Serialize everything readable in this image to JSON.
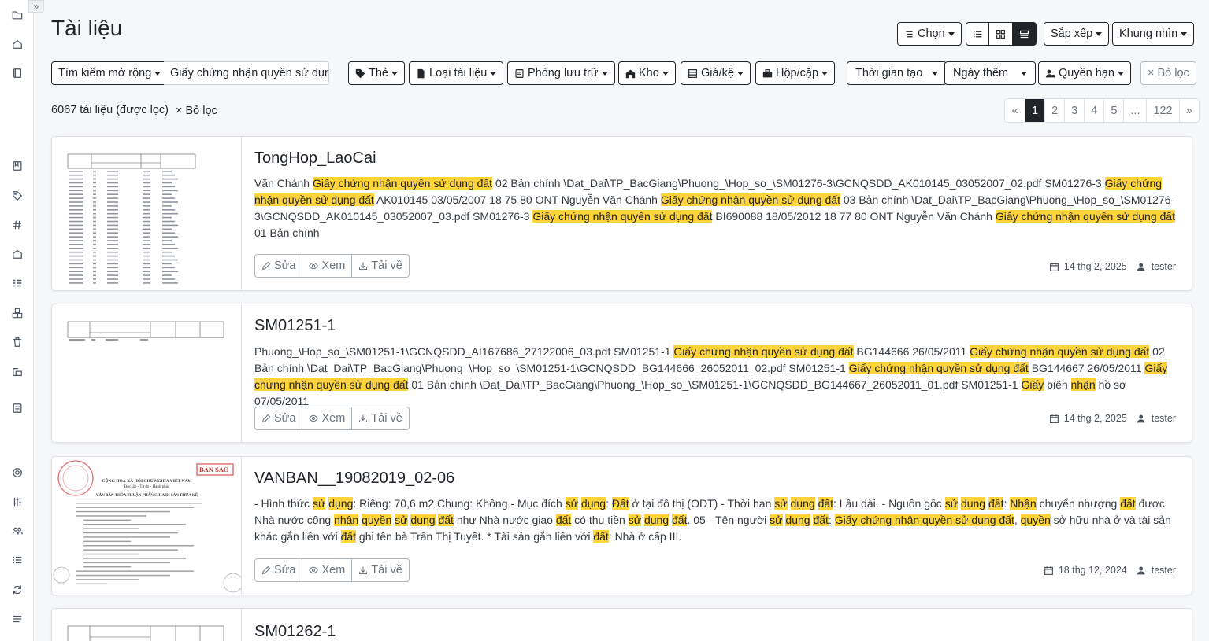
{
  "sidebar": {
    "toggle_icon": "chevron-double-right-icon",
    "icons": [
      "folder-icon",
      "home-icon",
      "documents-icon",
      "bookmark-icon",
      "tag-icon",
      "hash-icon",
      "storage-icon",
      "list-details-icon",
      "cubes-icon",
      "trash-icon",
      "box-icon",
      "file-text-icon",
      "settings-icon",
      "sliders-icon",
      "users-icon",
      "list-icon",
      "refresh-icon",
      "menu-icon"
    ]
  },
  "header": {
    "title": "Tài liệu",
    "select_label": "Chọn",
    "sort_label": "Sắp xếp",
    "view_label": "Khung nhìn"
  },
  "filters": {
    "extended_search_label": "Tìm kiếm mở rộng",
    "search_value": "Giấy chứng nhận quyền sử dụng đất",
    "tags_label": "Thẻ",
    "doctype_label": "Loại tài liệu",
    "archive_label": "Phòng lưu trữ",
    "warehouse_label": "Kho",
    "shelf_label": "Giá/kệ",
    "box_label": "Hộp/cặp",
    "created_label": "Thời gian tạo",
    "added_label": "Ngày thêm",
    "permissions_label": "Quyền hạn",
    "reset_label": "× Bỏ lọc"
  },
  "results": {
    "count_text": "6067 tài liệu (được lọc)",
    "clear_label": "Bỏ lọc"
  },
  "pagination": [
    "«",
    "1",
    "2",
    "3",
    "4",
    "5",
    "...",
    "122",
    "»"
  ],
  "actions": {
    "edit": "Sửa",
    "view": "Xem",
    "download": "Tải về"
  },
  "documents": [
    {
      "title": "TongHop_LaoCai",
      "body_parts": [
        {
          "t": "Văn Chánh ",
          "h": false
        },
        {
          "t": "Giấy chứng nhận quyền sử dụng đất",
          "h": true
        },
        {
          "t": " 02 Bản chính \\Dat_Dai\\TP_BacGiang\\Phuong_\\Hop_so_\\SM01276-3\\GCNQSDD_AK010145_03052007_02.pdf SM01276-3 ",
          "h": false
        },
        {
          "t": "Giấy chứng nhận quyền sử dụng đất",
          "h": true
        },
        {
          "t": " AK010145 03/05/2007 18 75 80 ONT Nguyễn Văn Chánh ",
          "h": false
        },
        {
          "t": "Giấy chứng nhận quyền sử dụng đất",
          "h": true
        },
        {
          "t": " 03 Bản chính \\Dat_Dai\\TP_BacGiang\\Phuong_\\Hop_so_\\SM01276-3\\GCNQSDD_AK010145_03052007_03.pdf SM01276-3 ",
          "h": false
        },
        {
          "t": "Giấy chứng nhận quyền sử dụng đất",
          "h": true
        },
        {
          "t": " BI690088 18/05/2012 18 77 80 ONT Nguyễn Văn Chánh ",
          "h": false
        },
        {
          "t": "Giấy chứng nhận quyền sử dụng đất",
          "h": true
        },
        {
          "t": " 01 Bản chính",
          "h": false
        }
      ],
      "date": "14 thg 2, 2025",
      "owner": "tester"
    },
    {
      "title": "SM01251-1",
      "body_parts": [
        {
          "t": "Phuong_\\Hop_so_\\SM01251-1\\GCNQSDD_AI167686_27122006_03.pdf SM01251-1 ",
          "h": false
        },
        {
          "t": "Giấy chứng nhận quyền sử dụng đất",
          "h": true
        },
        {
          "t": " BG144666 26/05/2011 ",
          "h": false
        },
        {
          "t": "Giấy chứng nhận quyền sử dụng đất",
          "h": true
        },
        {
          "t": " 02 Bản chính \\Dat_Dai\\TP_BacGiang\\Phuong_\\Hop_so_\\SM01251-1\\GCNQSDD_BG144666_26052011_02.pdf SM01251-1 ",
          "h": false
        },
        {
          "t": "Giấy chứng nhận quyền sử dụng đất",
          "h": true
        },
        {
          "t": " BG144667 26/05/2011 ",
          "h": false
        },
        {
          "t": "Giấy chứng nhận quyền sử dụng đất",
          "h": true
        },
        {
          "t": " 01 Bản chính \\Dat_Dai\\TP_BacGiang\\Phuong_\\Hop_so_\\SM01251-1\\GCNQSDD_BG144667_26052011_01.pdf SM01251-1 ",
          "h": false
        },
        {
          "t": "Giấy",
          "h": true
        },
        {
          "t": " biên ",
          "h": false
        },
        {
          "t": "nhận",
          "h": true
        },
        {
          "t": " hồ sơ 07/05/2011",
          "h": false
        }
      ],
      "date": "14 thg 2, 2025",
      "owner": "tester"
    },
    {
      "title": "VANBAN__19082019_02-06",
      "body_parts": [
        {
          "t": "- Hình thức ",
          "h": false
        },
        {
          "t": "sử",
          "h": true
        },
        {
          "t": " ",
          "h": false
        },
        {
          "t": "dụng",
          "h": true
        },
        {
          "t": ": Riêng: 70,6 m2 Chung: Không - Mục đích ",
          "h": false
        },
        {
          "t": "sử",
          "h": true
        },
        {
          "t": " ",
          "h": false
        },
        {
          "t": "dụng",
          "h": true
        },
        {
          "t": ": ",
          "h": false
        },
        {
          "t": "Đất",
          "h": true
        },
        {
          "t": " ở tại đô thị (ODT) - Thời hạn ",
          "h": false
        },
        {
          "t": "sử",
          "h": true
        },
        {
          "t": " ",
          "h": false
        },
        {
          "t": "dụng",
          "h": true
        },
        {
          "t": " ",
          "h": false
        },
        {
          "t": "đất",
          "h": true
        },
        {
          "t": ": Lâu dài. - Nguồn gốc ",
          "h": false
        },
        {
          "t": "sử",
          "h": true
        },
        {
          "t": " ",
          "h": false
        },
        {
          "t": "dụng",
          "h": true
        },
        {
          "t": " ",
          "h": false
        },
        {
          "t": "đất",
          "h": true
        },
        {
          "t": ": ",
          "h": false
        },
        {
          "t": "Nhận",
          "h": true
        },
        {
          "t": " chuyển nhượng ",
          "h": false
        },
        {
          "t": "đất",
          "h": true
        },
        {
          "t": " được Nhà nước cộng ",
          "h": false
        },
        {
          "t": "nhận",
          "h": true
        },
        {
          "t": " ",
          "h": false
        },
        {
          "t": "quyền",
          "h": true
        },
        {
          "t": " ",
          "h": false
        },
        {
          "t": "sử",
          "h": true
        },
        {
          "t": " ",
          "h": false
        },
        {
          "t": "dụng",
          "h": true
        },
        {
          "t": " ",
          "h": false
        },
        {
          "t": "đất",
          "h": true
        },
        {
          "t": " như Nhà nước giao ",
          "h": false
        },
        {
          "t": "đất",
          "h": true
        },
        {
          "t": " có thu tiền ",
          "h": false
        },
        {
          "t": "sử",
          "h": true
        },
        {
          "t": " ",
          "h": false
        },
        {
          "t": "dụng",
          "h": true
        },
        {
          "t": " ",
          "h": false
        },
        {
          "t": "đất",
          "h": true
        },
        {
          "t": ". 05 - Tên người ",
          "h": false
        },
        {
          "t": "sử",
          "h": true
        },
        {
          "t": " ",
          "h": false
        },
        {
          "t": "dụng",
          "h": true
        },
        {
          "t": " ",
          "h": false
        },
        {
          "t": "đất",
          "h": true
        },
        {
          "t": ": ",
          "h": false
        },
        {
          "t": "Giấy chứng nhận quyền sử dụng đất",
          "h": true
        },
        {
          "t": ", ",
          "h": false
        },
        {
          "t": "quyền",
          "h": true
        },
        {
          "t": " sở hữu nhà ở và tài sản khác gắn liền với ",
          "h": false
        },
        {
          "t": "đất",
          "h": true
        },
        {
          "t": " ghi tên bà Trần Thị Tuyết. * Tài sản gắn liền với ",
          "h": false
        },
        {
          "t": "đất",
          "h": true
        },
        {
          "t": ": Nhà ở cấp III.",
          "h": false
        }
      ],
      "date": "18 thg 12, 2024",
      "owner": "tester"
    },
    {
      "title": "SM01262-1",
      "body_parts": [],
      "date": "",
      "owner": ""
    }
  ],
  "thumbnails": {
    "stamp_text": "BẢN SAO",
    "doc3_header": "CỘNG HOÀ XÃ HỘI CHỦ NGHĨA VIỆT NAM",
    "doc3_sub": "Độc lập - Tự do - Hạnh phúc",
    "doc3_heading": "VĂN BẢN THỎA THUẬN PHÂN CHIA DI SẢN THỪA KẾ"
  }
}
